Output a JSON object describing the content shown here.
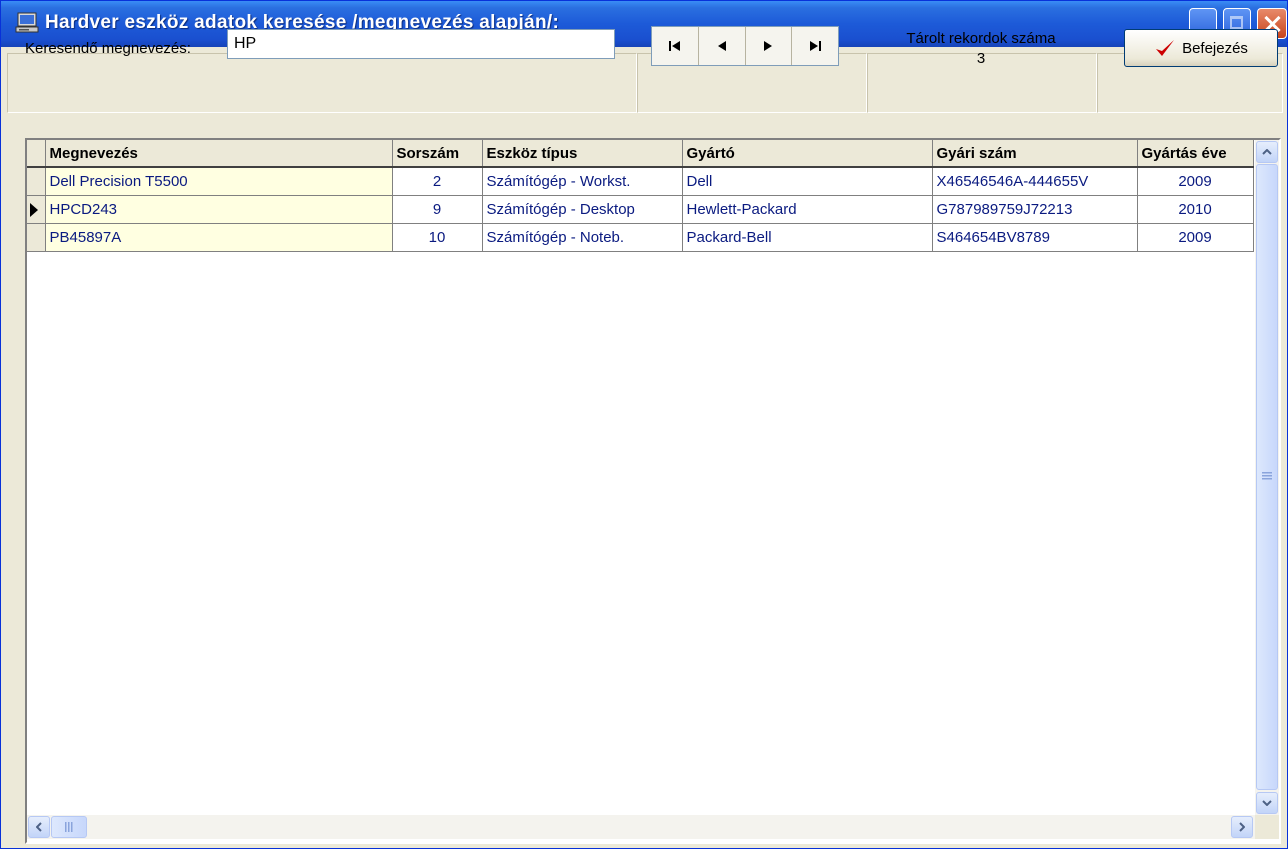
{
  "window": {
    "title": "Hardver eszköz adatok keresése /megnevezés alapján/:"
  },
  "search": {
    "label": "Keresendő megnevezés:",
    "value": "HP"
  },
  "nav": {
    "first": "⏮",
    "prev": "◄",
    "next": "►",
    "last": "⏭"
  },
  "records": {
    "label": "Tárolt rekordok száma",
    "count": "3"
  },
  "finish": {
    "label": "Befejezés"
  },
  "grid": {
    "columns": [
      "Megnevezés",
      "Sorszám",
      "Eszköz típus",
      "Gyártó",
      "Gyári szám",
      "Gyártás éve"
    ],
    "rows": [
      [
        "Dell Precision T5500",
        "2",
        "Számítógép - Workst.",
        "Dell",
        "X46546546A-444655V",
        "2009"
      ],
      [
        "HPCD243",
        "9",
        "Számítógép - Desktop",
        "Hewlett-Packard",
        "G787989759J72213",
        "2010"
      ],
      [
        "PB45897A",
        "10",
        "Számítógép - Noteb.",
        "Packard-Bell",
        "S464654BV8789",
        "2009"
      ]
    ],
    "current_row": 1
  },
  "colors": {
    "titlebar": "#1d5ad8",
    "grid_text": "#0a1a80",
    "name_cell": "#ffffe1",
    "check": "#cc0000"
  }
}
